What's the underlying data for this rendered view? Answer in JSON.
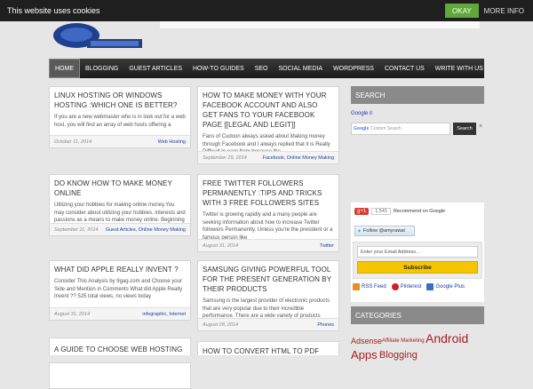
{
  "cookie": {
    "message": "This website uses cookies",
    "okay_label": "OKAY",
    "more_label": "MORE INFO"
  },
  "nav": {
    "items": [
      "HOME",
      "BLOGGING",
      "GUEST ARTICLES",
      "HOW-TO GUIDES",
      "SEO",
      "SOCIAL MEDIA",
      "WORDPRESS",
      "CONTACT US",
      "WRITE WITH US"
    ]
  },
  "posts": [
    {
      "title": "LINUX HOSTING OR WINDOWS HOSTING :WHICH ONE IS BETTER?",
      "excerpt": "If you are a new webmaster who is in look out for a web host, you will find an array of web hosts offering a",
      "date": "October 11, 2014",
      "categories": "Web Hosting"
    },
    {
      "title": "HOW TO MAKE MONEY WITH YOUR FACEBOOK ACCOUNT AND ALSO GET FANS TO YOUR FACEBOOK PAGE [[LEGAL AND LEGIT]]",
      "excerpt": "Fans of Cudoon always asked about Making money through Facebook and I always replied that it is Really Difficult to earn from because the",
      "date": "September 29, 2014",
      "categories": "Facebook, Online Money Making"
    },
    {
      "title": "DO KNOW HOW TO MAKE MONEY ONLINE",
      "excerpt": "Utilizing your hobbies for making online money.You may consider about utilizing your hobbies, interests and passions as a means to make money online. Beginning",
      "date": "September 11, 2014",
      "categories": "Guest Articles, Online Money Making"
    },
    {
      "title": "FREE TWITTER FOLLOWERS PERMANENTLY :TIPS AND TRICKS WITH 3 FREE FOLLOWERS SITES",
      "excerpt": "Twitter is growing rapidly and a many people are seeking information about how to increase Twitter followers Permanently. Unless you're the president or a famous person like",
      "date": "August 31, 2014",
      "categories": "Twitter"
    },
    {
      "title": "WHAT DID APPLE REALLY INVENT ?",
      "excerpt": "Consider This Analysis by 9gag.com and Choose your Side and Mention in Comments What did Apple Really Invent ?? 525 total views, no views today",
      "date": "August 31, 2014",
      "categories": "infographic, Internet"
    },
    {
      "title": "SAMSUNG GIVING POWERFUL TOOL FOR THE PRESENT GENERATION BY THEIR PRODUCTS",
      "excerpt": "Samsung is the largest provider of electronic products that are very popular due to their incredible performance. There are a wide variety of products manufactured",
      "date": "August 28, 2014",
      "categories": "Phones"
    },
    {
      "title": "A GUIDE TO CHOOSE WEB HOSTING COMPANY",
      "excerpt": "",
      "date": "",
      "categories": ""
    },
    {
      "title": "HOW TO CONVERT HTML TO PDF USING C#",
      "excerpt": "",
      "date": "",
      "categories": ""
    }
  ],
  "sidebar": {
    "search_heading": "SEARCH",
    "google_it": "Google it",
    "search_placeholder": "Custom Search",
    "search_button": "Search",
    "search_clear": "×",
    "gplus_label": "g+1",
    "gplus_count": "1,541",
    "gplus_text": "Recommend on Google",
    "follow_label": "Follow @amyrawat",
    "email_placeholder": "Enter your Email Address...",
    "subscribe_label": "Subscribe",
    "social": [
      "RSS Feed",
      "Pinterest",
      "Google Plus"
    ],
    "categories_heading": "CATEGORIES",
    "tags": [
      "Adsense",
      "Affiliate Marketing",
      "Android",
      "Apps",
      "Blogging"
    ]
  },
  "colors": {
    "accent_link": "#1b3fa0",
    "tag_red": "#a41e1e",
    "cookie_ok": "#5fa83a",
    "subscribe": "#f5c500"
  }
}
